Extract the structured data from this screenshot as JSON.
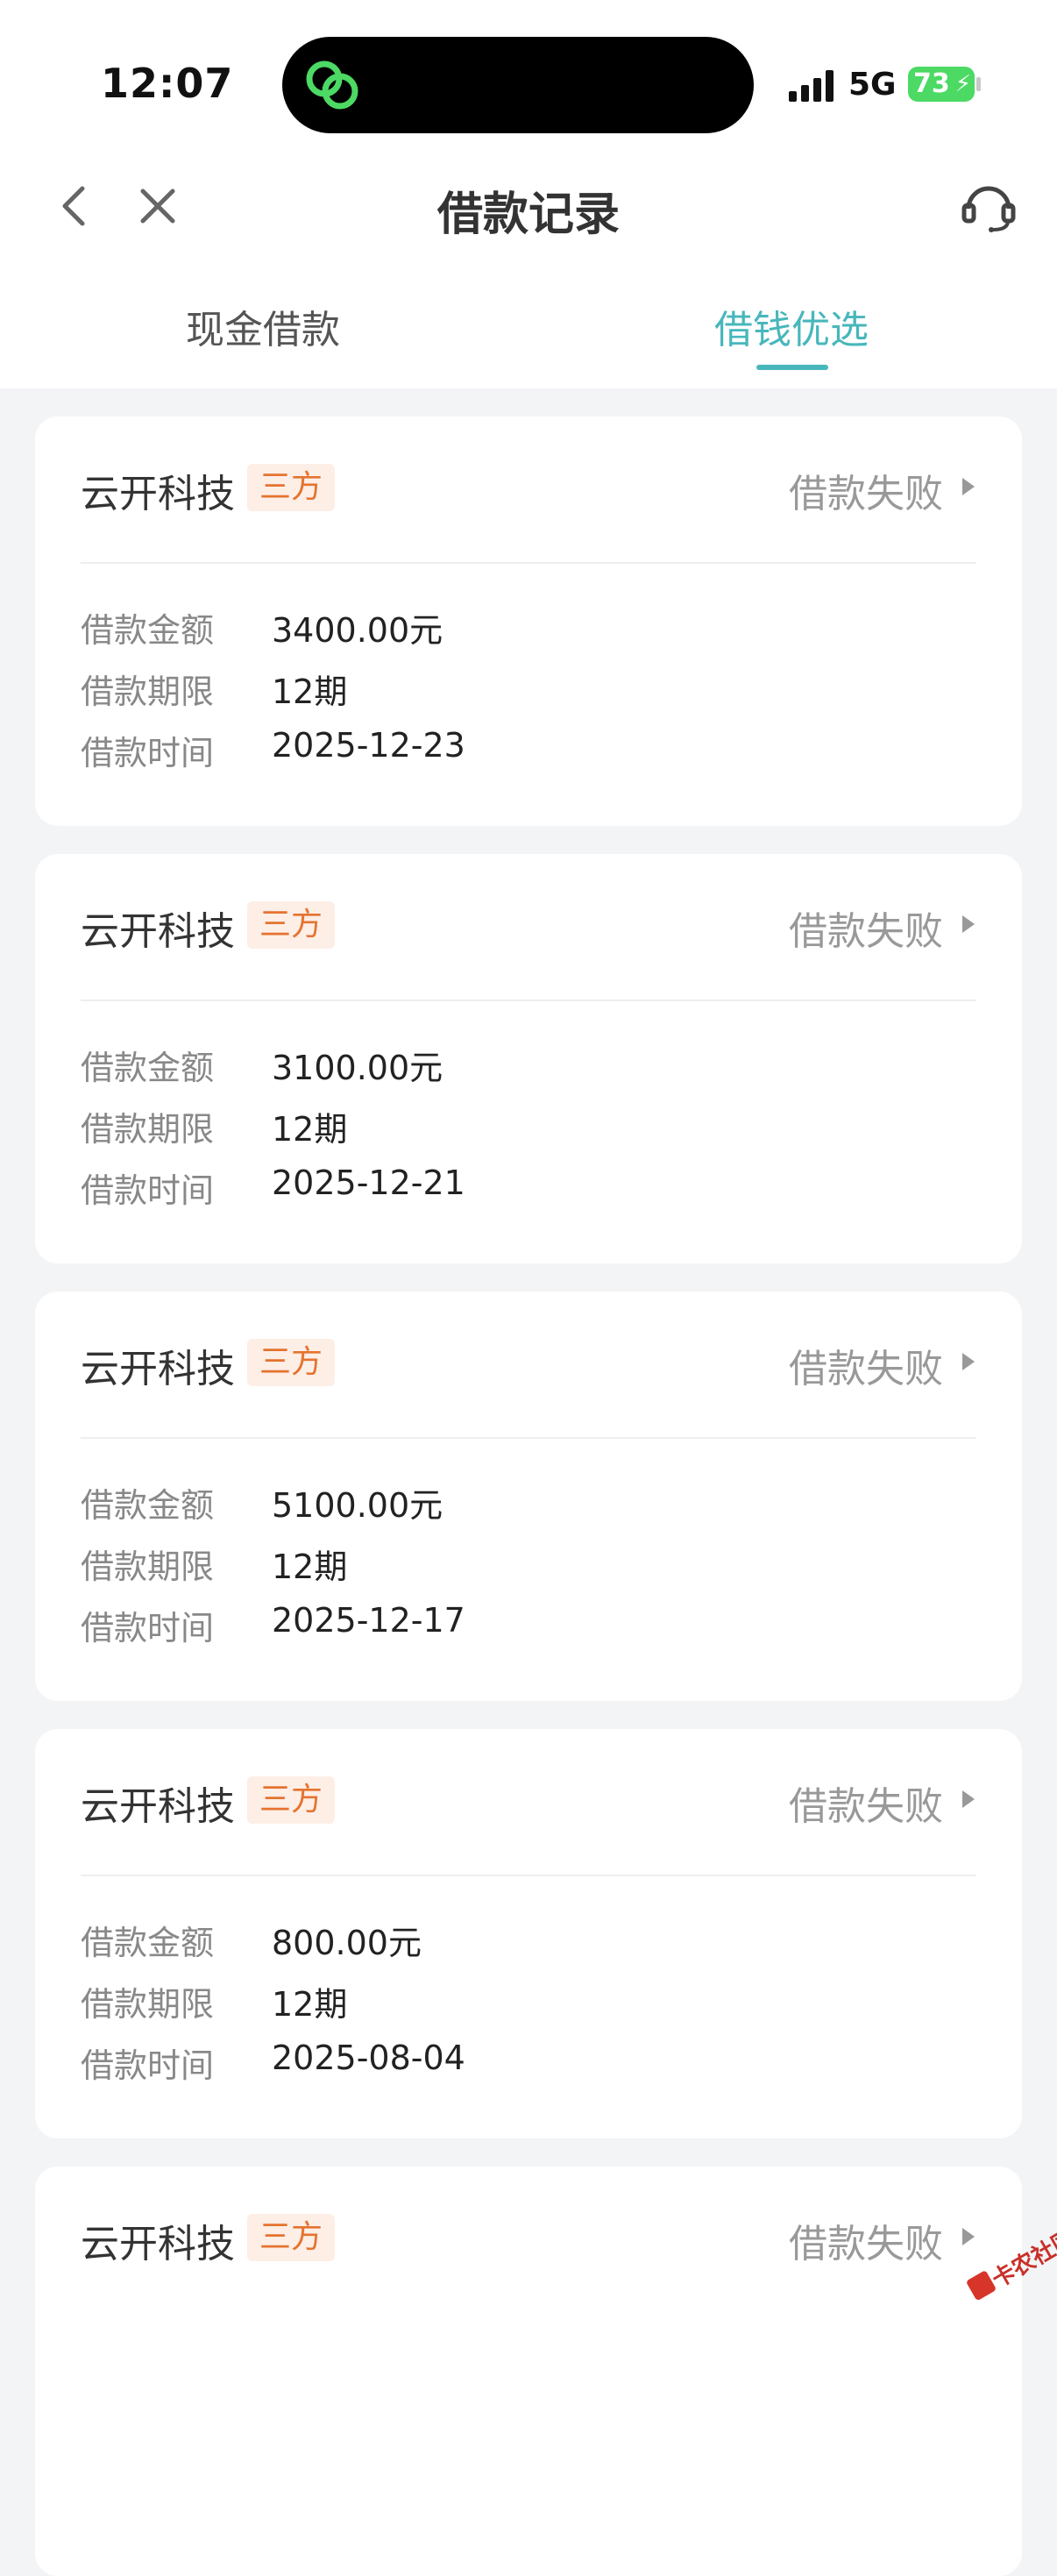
{
  "status_bar": {
    "time": "12:07",
    "network": "5G",
    "battery": "73",
    "island_app_icon": "green-linked-rings-icon"
  },
  "nav": {
    "title": "借款记录",
    "back_icon": "chevron-left-icon",
    "close_icon": "close-icon",
    "service_icon": "headset-icon"
  },
  "tabs": [
    {
      "label": "现金借款",
      "active": false
    },
    {
      "label": "借钱优选",
      "active": true
    }
  ],
  "colors": {
    "accent": "#47b7bb",
    "tag_text": "#e5732f",
    "tag_bg": "#fdeee6",
    "page_bg": "#f3f4f6"
  },
  "records": [
    {
      "company": "云开科技",
      "tag": "三方",
      "status": "借款失败",
      "rows": [
        {
          "label": "借款金额",
          "value": "3400.00元"
        },
        {
          "label": "借款期限",
          "value": "12期"
        },
        {
          "label": "借款时间",
          "value": "2025-12-23"
        }
      ]
    },
    {
      "company": "云开科技",
      "tag": "三方",
      "status": "借款失败",
      "rows": [
        {
          "label": "借款金额",
          "value": "3100.00元"
        },
        {
          "label": "借款期限",
          "value": "12期"
        },
        {
          "label": "借款时间",
          "value": "2025-12-21"
        }
      ]
    },
    {
      "company": "云开科技",
      "tag": "三方",
      "status": "借款失败",
      "rows": [
        {
          "label": "借款金额",
          "value": "5100.00元"
        },
        {
          "label": "借款期限",
          "value": "12期"
        },
        {
          "label": "借款时间",
          "value": "2025-12-17"
        }
      ]
    },
    {
      "company": "云开科技",
      "tag": "三方",
      "status": "借款失败",
      "rows": [
        {
          "label": "借款金额",
          "value": "800.00元"
        },
        {
          "label": "借款期限",
          "value": "12期"
        },
        {
          "label": "借款时间",
          "value": "2025-08-04"
        }
      ]
    },
    {
      "company": "云开科技",
      "tag": "三方",
      "status": "借款失败",
      "rows": []
    }
  ],
  "watermark": {
    "text": "卡农社区"
  }
}
